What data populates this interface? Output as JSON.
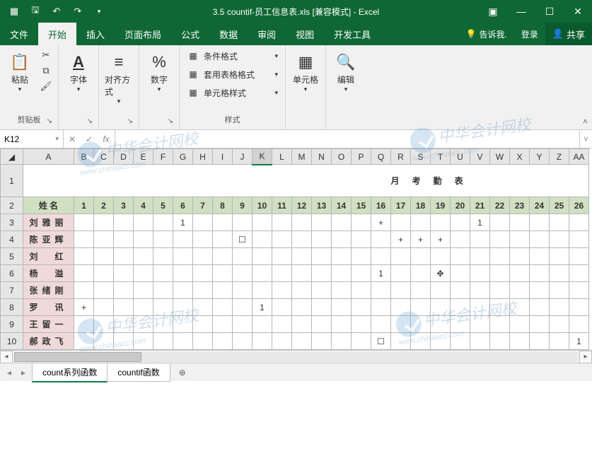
{
  "titlebar": {
    "title": "3.5 countif-员工信息表.xls [兼容模式] - Excel"
  },
  "tabs": {
    "file": "文件",
    "home": "开始",
    "insert": "插入",
    "layout": "页面布局",
    "formulas": "公式",
    "data": "数据",
    "review": "审阅",
    "view": "视图",
    "dev": "开发工具",
    "tellme": "告诉我.",
    "signin": "登录",
    "share": "共享"
  },
  "ribbon": {
    "clipboard": {
      "label": "剪贴板",
      "paste": "粘贴"
    },
    "font": {
      "label": "字体"
    },
    "align": {
      "label": "对齐方式"
    },
    "number": {
      "label": "数字"
    },
    "styles": {
      "label": "样式",
      "cond": "条件格式",
      "table": "套用表格格式",
      "cell": "单元格样式"
    },
    "cells": {
      "label": "单元格"
    },
    "editing": {
      "label": "编辑"
    }
  },
  "fxbar": {
    "cellref": "K12",
    "formula": ""
  },
  "columns": [
    "A",
    "B",
    "C",
    "D",
    "E",
    "F",
    "G",
    "H",
    "I",
    "J",
    "K",
    "L",
    "M",
    "N",
    "O",
    "P",
    "Q",
    "R",
    "S",
    "T",
    "U",
    "V",
    "W",
    "X",
    "Y",
    "Z",
    "AA"
  ],
  "selected_col_index": 10,
  "title_cell": "月考勤表",
  "header_row": {
    "name_label": "姓 名",
    "days": [
      "1",
      "2",
      "3",
      "4",
      "5",
      "6",
      "7",
      "8",
      "9",
      "10",
      "11",
      "12",
      "13",
      "14",
      "15",
      "16",
      "17",
      "18",
      "19",
      "20",
      "21",
      "22",
      "23",
      "24",
      "25",
      "26"
    ]
  },
  "rows": [
    {
      "r": 3,
      "name": "刘雅丽",
      "cells": {
        "6": "1",
        "16": "+",
        "21": "1"
      }
    },
    {
      "r": 4,
      "name": "陈亚辉",
      "cells": {
        "9": "☐",
        "17": "+",
        "18": "+",
        "19": "+"
      }
    },
    {
      "r": 5,
      "name": "刘　红",
      "cells": {}
    },
    {
      "r": 6,
      "name": "杨　溢",
      "cells": {
        "16": "1",
        "19": "✥"
      }
    },
    {
      "r": 7,
      "name": "张绪刚",
      "cells": {}
    },
    {
      "r": 8,
      "name": "罗　讯",
      "cells": {
        "1": "+",
        "10": "1"
      }
    },
    {
      "r": 9,
      "name": "王留一",
      "cells": {}
    },
    {
      "r": 10,
      "name": "郝政飞",
      "cells": {
        "16": "☐",
        "26": "1"
      }
    }
  ],
  "sheets": {
    "tab1": "count系列函数",
    "tab2": "countif函数"
  },
  "watermark": {
    "text": "中华会计网校",
    "url": "www.chinaacc.com"
  },
  "chart_data": {
    "type": "table",
    "title": "月考勤表",
    "columns": [
      "姓名",
      "1",
      "2",
      "3",
      "4",
      "5",
      "6",
      "7",
      "8",
      "9",
      "10",
      "11",
      "12",
      "13",
      "14",
      "15",
      "16",
      "17",
      "18",
      "19",
      "20",
      "21",
      "22",
      "23",
      "24",
      "25",
      "26"
    ],
    "rows": [
      [
        "刘雅丽",
        "",
        "",
        "",
        "",
        "",
        "1",
        "",
        "",
        "",
        "",
        "",
        "",
        "",
        "",
        "",
        "+",
        "",
        "",
        "",
        "",
        "1",
        "",
        "",
        "",
        "",
        ""
      ],
      [
        "陈亚辉",
        "",
        "",
        "",
        "",
        "",
        "",
        "",
        "",
        "☐",
        "",
        "",
        "",
        "",
        "",
        "",
        "",
        "+",
        "+",
        "+",
        "",
        "",
        "",
        "",
        "",
        "",
        ""
      ],
      [
        "刘红",
        "",
        "",
        "",
        "",
        "",
        "",
        "",
        "",
        "",
        "",
        "",
        "",
        "",
        "",
        "",
        "",
        "",
        "",
        "",
        "",
        "",
        "",
        "",
        "",
        "",
        ""
      ],
      [
        "杨溢",
        "",
        "",
        "",
        "",
        "",
        "",
        "",
        "",
        "",
        "",
        "",
        "",
        "",
        "",
        "",
        "1",
        "",
        "",
        "✥",
        "",
        "",
        "",
        "",
        "",
        "",
        ""
      ],
      [
        "张绪刚",
        "",
        "",
        "",
        "",
        "",
        "",
        "",
        "",
        "",
        "",
        "",
        "",
        "",
        "",
        "",
        "",
        "",
        "",
        "",
        "",
        "",
        "",
        "",
        "",
        "",
        ""
      ],
      [
        "罗讯",
        "+",
        "",
        "",
        "",
        "",
        "",
        "",
        "",
        "",
        "1",
        "",
        "",
        "",
        "",
        "",
        "",
        "",
        "",
        "",
        "",
        "",
        "",
        "",
        "",
        "",
        ""
      ],
      [
        "王留一",
        "",
        "",
        "",
        "",
        "",
        "",
        "",
        "",
        "",
        "",
        "",
        "",
        "",
        "",
        "",
        "",
        "",
        "",
        "",
        "",
        "",
        "",
        "",
        "",
        "",
        ""
      ],
      [
        "郝政飞",
        "",
        "",
        "",
        "",
        "",
        "",
        "",
        "",
        "",
        "",
        "",
        "",
        "",
        "",
        "",
        "☐",
        "",
        "",
        "",
        "",
        "",
        "",
        "",
        "",
        "",
        "1"
      ]
    ]
  }
}
